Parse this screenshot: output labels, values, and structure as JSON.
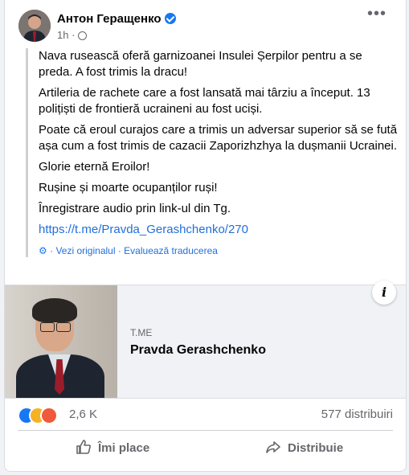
{
  "post": {
    "author": "Антон Геращенко",
    "time": "1h",
    "more_icon": "•••"
  },
  "body": {
    "paragraphs": [
      "Nava rusească oferă garnizoanei Insulei Șerpilor pentru a se preda. A fost trimis la dracu!",
      "Artileria de rachete care a fost lansată mai târziu a început. 13 polițiști de frontieră ucraineni au fost uciși.",
      "Poate că eroul curajos care a trimis un adversar superior să se fută așa cum a fost trimis de cazacii Zaporizhzhya la dușmanii Ucrainei.",
      "Glorie eternă Eroilor!",
      "Rușine și moarte ocupanților ruși!",
      "Înregistrare audio prin link-ul din Tg."
    ],
    "link": "https://t.me/Pravda_Gerashchenko/270",
    "see_original": "Vezi originalul",
    "separator": " · ",
    "rate_translation": "Evaluează traducerea"
  },
  "preview": {
    "site": "T.ME",
    "title": "Pravda Gerashchenko",
    "info_label": "i"
  },
  "stats": {
    "reactions_count": "2,6 K",
    "shares": "577 distribuiri"
  },
  "actions": {
    "like": "Îmi place",
    "share": "Distribuie"
  },
  "colors": {
    "accent": "#1877f2",
    "link": "#216fdb",
    "muted": "#65676b"
  }
}
